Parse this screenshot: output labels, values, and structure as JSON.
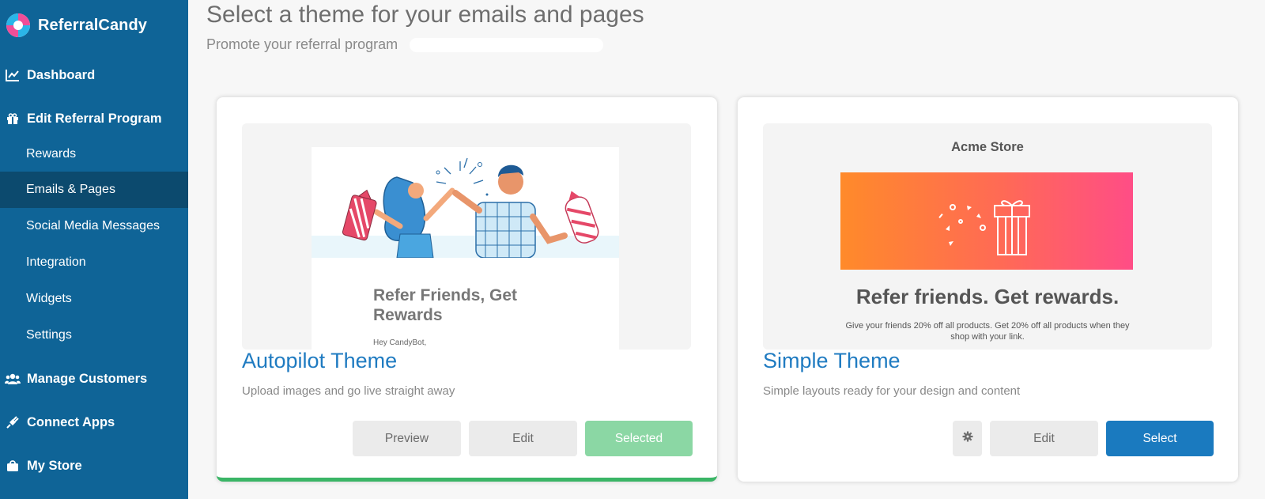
{
  "brand": {
    "name": "ReferralCandy"
  },
  "sidebar": {
    "items": [
      {
        "label": "Dashboard",
        "icon": "chart-line-icon",
        "type": "main"
      },
      {
        "label": "Edit Referral Program",
        "icon": "gift-icon",
        "type": "main"
      },
      {
        "label": "Rewards",
        "type": "sub"
      },
      {
        "label": "Emails & Pages",
        "type": "sub",
        "active": true
      },
      {
        "label": "Social Media Messages",
        "type": "sub"
      },
      {
        "label": "Integration",
        "type": "sub"
      },
      {
        "label": "Widgets",
        "type": "sub"
      },
      {
        "label": "Settings",
        "type": "sub"
      },
      {
        "label": "Manage Customers",
        "icon": "users-icon",
        "type": "main"
      },
      {
        "label": "Connect Apps",
        "icon": "plug-icon",
        "type": "main"
      },
      {
        "label": "My Store",
        "icon": "store-icon",
        "type": "main"
      }
    ]
  },
  "header": {
    "title": "Select a theme for your emails and pages",
    "subtitle": "Promote your referral program"
  },
  "themes": [
    {
      "name": "Autopilot Theme",
      "description": "Upload images and go live straight away",
      "preview": {
        "heading": "Refer Friends, Get Rewards",
        "greeting": "Hey CandyBot,"
      },
      "buttons": {
        "preview": "Preview",
        "edit": "Edit",
        "selected": "Selected"
      },
      "selected": true
    },
    {
      "name": "Simple Theme",
      "description": "Simple layouts ready for your design and content",
      "preview": {
        "store": "Acme Store",
        "heading": "Refer friends. Get rewards.",
        "body": "Give your friends 20% off all products. Get 20% off all products when they shop with your link."
      },
      "buttons": {
        "settings_icon": "gear-icon",
        "edit": "Edit",
        "select": "Select"
      },
      "selected": false
    }
  ],
  "colors": {
    "sidebar": "#0f6497",
    "sidebar_active": "#0c4a6e",
    "accent": "#1a7abf",
    "selected_green": "#8bd7a4",
    "selected_bar": "#3ab566"
  }
}
